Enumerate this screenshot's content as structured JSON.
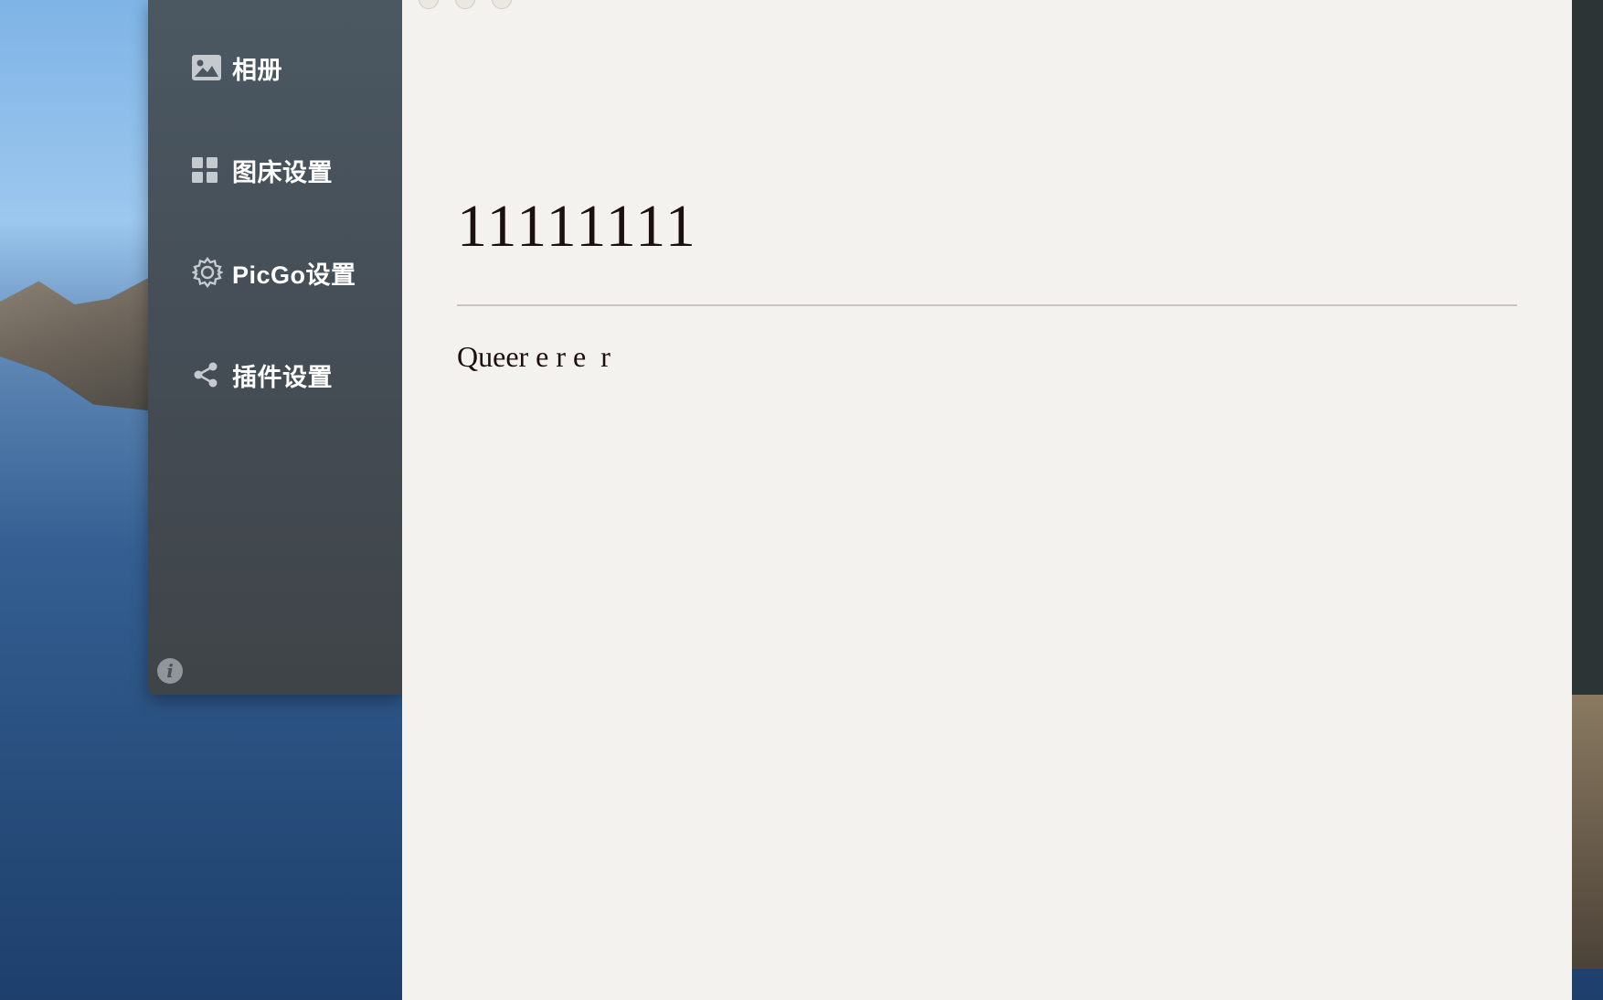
{
  "sidebar": {
    "items": [
      {
        "label": "相册",
        "icon": "image-icon"
      },
      {
        "label": "图床设置",
        "icon": "grid-icon"
      },
      {
        "label": "PicGo设置",
        "icon": "gear-icon"
      },
      {
        "label": "插件设置",
        "icon": "share-icon"
      }
    ],
    "info_icon": "info-icon",
    "info_glyph": "i"
  },
  "editor": {
    "heading": "11111111",
    "paragraph": "Queer e r e  r"
  },
  "colors": {
    "sidebar_bg": "#4b5862",
    "editor_bg": "#f4f2ee",
    "text": "#1c0f0f",
    "rule": "#c9c6c1"
  }
}
